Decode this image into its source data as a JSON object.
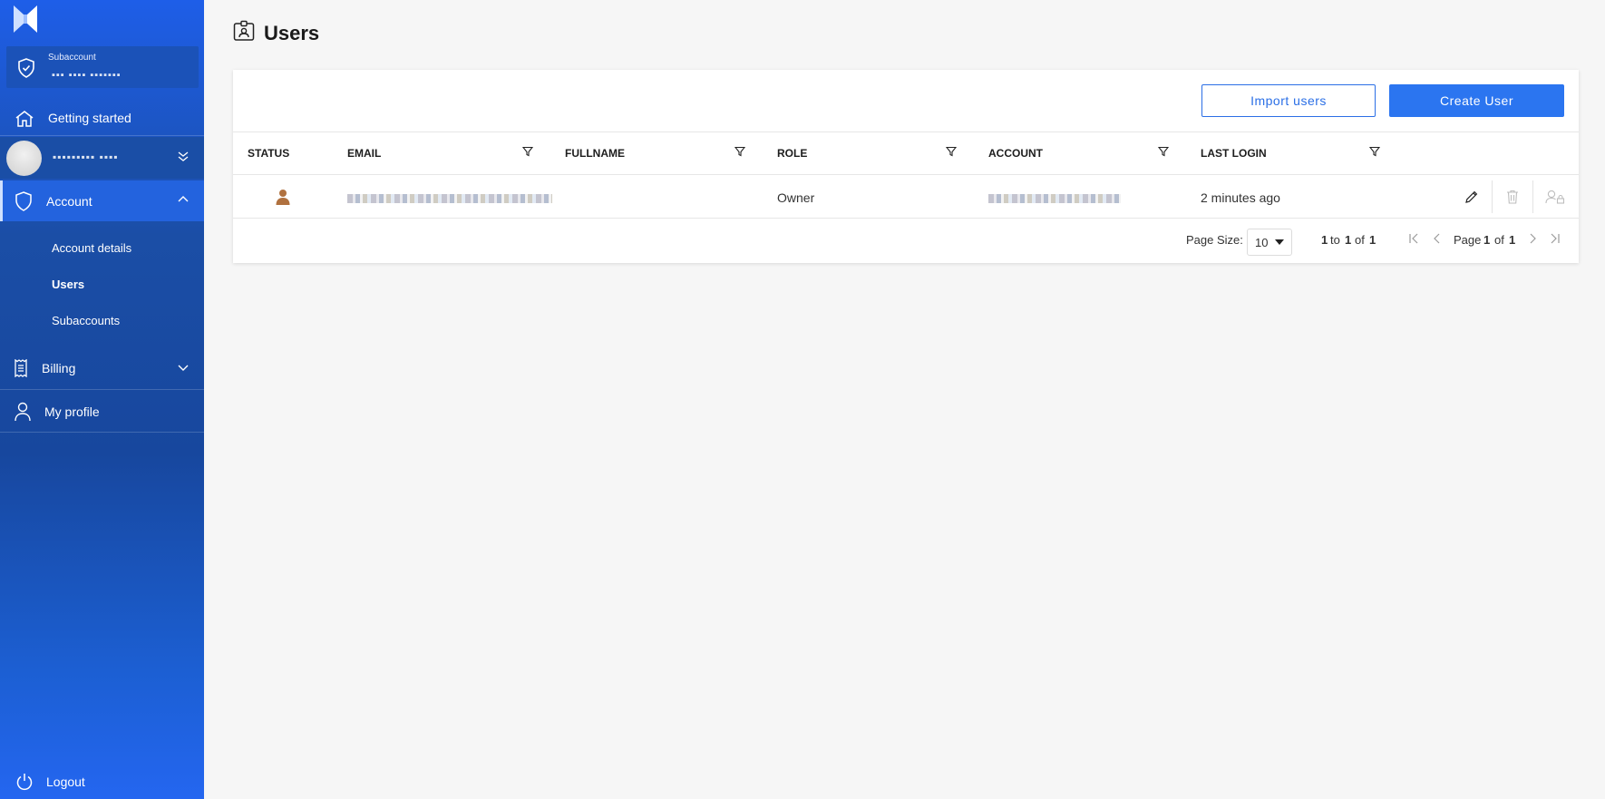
{
  "sidebar": {
    "subaccount_label": "Subaccount",
    "subaccount_name": "▪▪▪ ▪▪▪▪ ▪▪▪▪▪▪▪",
    "getting_started": "Getting started",
    "user_name": "▪▪▪▪▪▪▪▪▪ ▪▪▪▪",
    "account": "Account",
    "account_items": [
      "Account details",
      "Users",
      "Subaccounts"
    ],
    "billing": "Billing",
    "my_profile": "My profile",
    "logout": "Logout"
  },
  "page": {
    "title": "Users"
  },
  "toolbar": {
    "import_label": "Import users",
    "create_label": "Create User"
  },
  "table": {
    "columns": [
      "STATUS",
      "EMAIL",
      "FULLNAME",
      "ROLE",
      "ACCOUNT",
      "LAST LOGIN"
    ],
    "rows": [
      {
        "status": "active-user",
        "email": "",
        "fullname": "",
        "role": "Owner",
        "account": "",
        "last_login": "2 minutes ago"
      }
    ]
  },
  "pagination": {
    "page_size_label": "Page Size:",
    "page_size": "10",
    "range_from": "1",
    "range_to_word": "to",
    "range_to": "1",
    "range_of_word": "of",
    "range_total": "1",
    "page_word": "Page",
    "page_current": "1",
    "page_of_word": "of",
    "page_total": "1"
  },
  "colors": {
    "primary": "#2b75f0",
    "sidebar": "#1b4ea6",
    "status_user": "#b0713f"
  }
}
